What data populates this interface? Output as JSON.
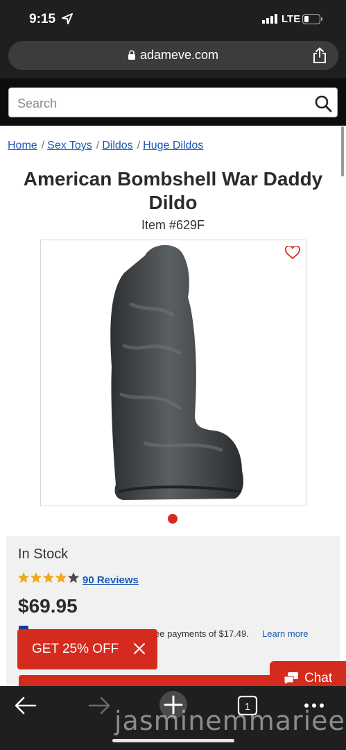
{
  "status_bar": {
    "time": "9:15",
    "network": "LTE"
  },
  "browser": {
    "domain": "adameve.com"
  },
  "search": {
    "placeholder": "Search"
  },
  "breadcrumb": [
    "Home",
    "Sex Toys",
    "Dildos",
    "Huge Dildos"
  ],
  "product": {
    "title": "American Bombshell War Daddy Dildo",
    "item_number": "Item #629F",
    "availability": "In Stock",
    "rating": 4.5,
    "reviews_label": "90 Reviews",
    "price": "$69.95",
    "installments_text": "ee payments of $17.49.",
    "learn_more": "Learn more"
  },
  "promo": {
    "label": "GET 25% OFF"
  },
  "chat": {
    "label": "Chat"
  },
  "toolbar": {
    "tab_count": "1"
  },
  "watermark": "jasminemmarieee",
  "colors": {
    "accent": "#d52b1e",
    "link": "#1c59b5",
    "chrome": "#1f1f21",
    "star": "#f0a81c"
  }
}
